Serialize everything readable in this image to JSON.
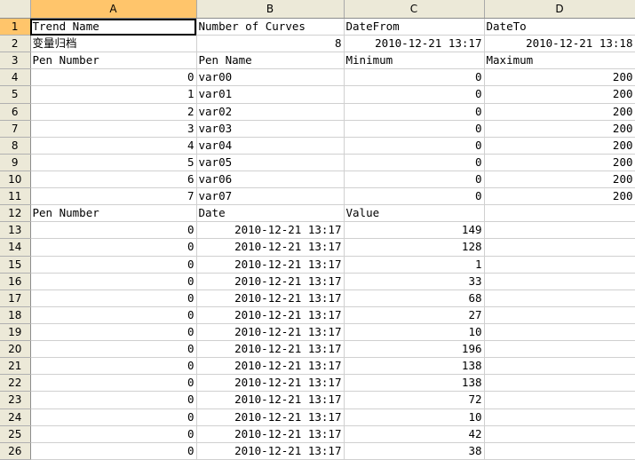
{
  "columns": [
    "A",
    "B",
    "C",
    "D"
  ],
  "rows": [
    {
      "n": "1",
      "a": "Trend Name",
      "b": "Number of Curves",
      "c": "DateFrom",
      "d": "DateTo"
    },
    {
      "n": "2",
      "a": "变量归档",
      "b": "8",
      "c": "2010-12-21 13:17",
      "d": "2010-12-21 13:18"
    },
    {
      "n": "3",
      "a": "Pen Number",
      "b": "Pen Name",
      "c": "Minimum",
      "d": "Maximum"
    },
    {
      "n": "4",
      "a": "0",
      "b": "var00",
      "c": "0",
      "d": "200"
    },
    {
      "n": "5",
      "a": "1",
      "b": "var01",
      "c": "0",
      "d": "200"
    },
    {
      "n": "6",
      "a": "2",
      "b": "var02",
      "c": "0",
      "d": "200"
    },
    {
      "n": "7",
      "a": "3",
      "b": "var03",
      "c": "0",
      "d": "200"
    },
    {
      "n": "8",
      "a": "4",
      "b": "var04",
      "c": "0",
      "d": "200"
    },
    {
      "n": "9",
      "a": "5",
      "b": "var05",
      "c": "0",
      "d": "200"
    },
    {
      "n": "10",
      "a": "6",
      "b": "var06",
      "c": "0",
      "d": "200"
    },
    {
      "n": "11",
      "a": "7",
      "b": "var07",
      "c": "0",
      "d": "200"
    },
    {
      "n": "12",
      "a": "Pen Number",
      "b": "Date",
      "c": "Value",
      "d": ""
    },
    {
      "n": "13",
      "a": "0",
      "b": "2010-12-21 13:17",
      "c": "149",
      "d": ""
    },
    {
      "n": "14",
      "a": "0",
      "b": "2010-12-21 13:17",
      "c": "128",
      "d": ""
    },
    {
      "n": "15",
      "a": "0",
      "b": "2010-12-21 13:17",
      "c": "1",
      "d": ""
    },
    {
      "n": "16",
      "a": "0",
      "b": "2010-12-21 13:17",
      "c": "33",
      "d": ""
    },
    {
      "n": "17",
      "a": "0",
      "b": "2010-12-21 13:17",
      "c": "68",
      "d": ""
    },
    {
      "n": "18",
      "a": "0",
      "b": "2010-12-21 13:17",
      "c": "27",
      "d": ""
    },
    {
      "n": "19",
      "a": "0",
      "b": "2010-12-21 13:17",
      "c": "10",
      "d": ""
    },
    {
      "n": "20",
      "a": "0",
      "b": "2010-12-21 13:17",
      "c": "196",
      "d": ""
    },
    {
      "n": "21",
      "a": "0",
      "b": "2010-12-21 13:17",
      "c": "138",
      "d": ""
    },
    {
      "n": "22",
      "a": "0",
      "b": "2010-12-21 13:17",
      "c": "138",
      "d": ""
    },
    {
      "n": "23",
      "a": "0",
      "b": "2010-12-21 13:17",
      "c": "72",
      "d": ""
    },
    {
      "n": "24",
      "a": "0",
      "b": "2010-12-21 13:17",
      "c": "10",
      "d": ""
    },
    {
      "n": "25",
      "a": "0",
      "b": "2010-12-21 13:17",
      "c": "42",
      "d": ""
    },
    {
      "n": "26",
      "a": "0",
      "b": "2010-12-21 13:17",
      "c": "38",
      "d": ""
    }
  ]
}
